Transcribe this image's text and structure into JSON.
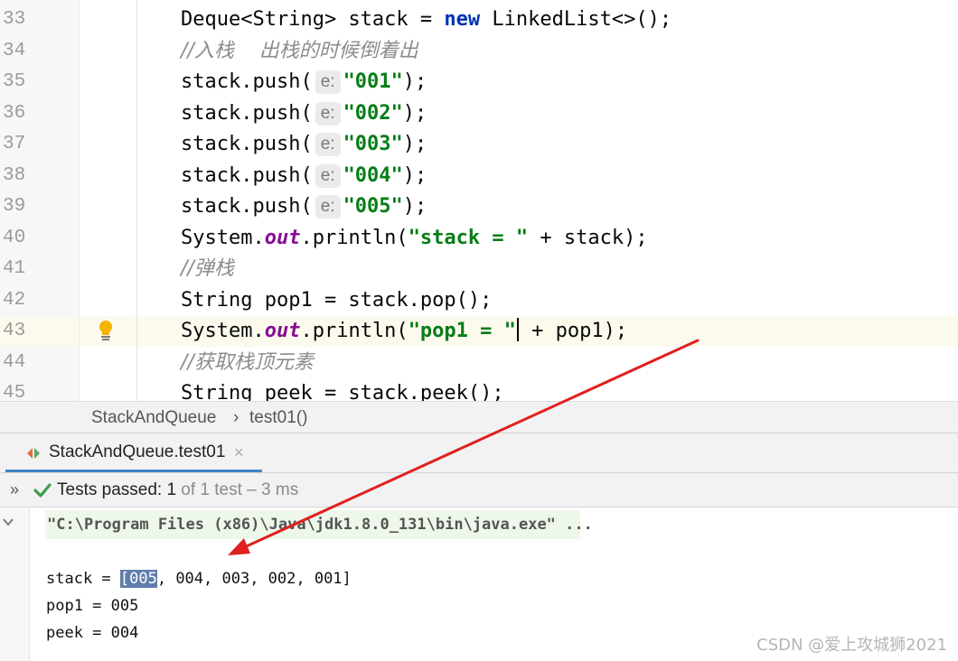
{
  "editor": {
    "lines": [
      {
        "num": "33",
        "parts": [
          [
            "t",
            "Deque<String> stack = "
          ],
          [
            "kw",
            "new"
          ],
          [
            "t",
            " LinkedList<>();"
          ]
        ]
      },
      {
        "num": "34",
        "parts": [
          [
            "cmt",
            "//入栈    出栈的时候倒着出"
          ]
        ]
      },
      {
        "num": "35",
        "parts": [
          [
            "t",
            "stack.push("
          ],
          [
            "hint",
            "e:"
          ],
          [
            "str",
            "\"001\""
          ],
          [
            "t",
            ");"
          ]
        ]
      },
      {
        "num": "36",
        "parts": [
          [
            "t",
            "stack.push("
          ],
          [
            "hint",
            "e:"
          ],
          [
            "str",
            "\"002\""
          ],
          [
            "t",
            ");"
          ]
        ]
      },
      {
        "num": "37",
        "parts": [
          [
            "t",
            "stack.push("
          ],
          [
            "hint",
            "e:"
          ],
          [
            "str",
            "\"003\""
          ],
          [
            "t",
            ");"
          ]
        ]
      },
      {
        "num": "38",
        "parts": [
          [
            "t",
            "stack.push("
          ],
          [
            "hint",
            "e:"
          ],
          [
            "str",
            "\"004\""
          ],
          [
            "t",
            ");"
          ]
        ]
      },
      {
        "num": "39",
        "parts": [
          [
            "t",
            "stack.push("
          ],
          [
            "hint",
            "e:"
          ],
          [
            "str",
            "\"005\""
          ],
          [
            "t",
            ");"
          ]
        ]
      },
      {
        "num": "40",
        "parts": [
          [
            "t",
            "System."
          ],
          [
            "field",
            "out"
          ],
          [
            "t",
            ".println("
          ],
          [
            "str",
            "\"stack = \""
          ],
          [
            "t",
            " + stack);"
          ]
        ]
      },
      {
        "num": "41",
        "parts": [
          [
            "cmt",
            "//弹栈"
          ]
        ]
      },
      {
        "num": "42",
        "parts": [
          [
            "t",
            "String pop1 = stack.pop();"
          ]
        ]
      },
      {
        "num": "43",
        "current": true,
        "bulb": true,
        "parts": [
          [
            "t",
            "System."
          ],
          [
            "field",
            "out"
          ],
          [
            "t",
            ".println("
          ],
          [
            "str",
            "\"pop1 = \""
          ],
          [
            "caret",
            ""
          ],
          [
            "t",
            " + pop1);"
          ]
        ]
      },
      {
        "num": "44",
        "parts": [
          [
            "cmt",
            "//获取栈顶元素"
          ]
        ]
      },
      {
        "num": "45",
        "parts": [
          [
            "t",
            "String peek = stack.peek();"
          ]
        ]
      }
    ]
  },
  "breadcrumb": {
    "class_name": "StackAndQueue",
    "separator": "›",
    "method": "test01()"
  },
  "run_tab": {
    "label": "StackAndQueue.test01",
    "close": "×",
    "icon": "run-config-icon"
  },
  "status": {
    "expand": "»",
    "label": "Tests passed: ",
    "count": "1",
    "tail": " of 1 test – 3 ms",
    "icon": "check-icon"
  },
  "console": {
    "collapse": "✓",
    "command": "\"C:\\Program Files (x86)\\Java\\jdk1.8.0_131\\bin\\java.exe\" ...",
    "stack_prefix": "stack = ",
    "stack_selected": "[005",
    "stack_rest": ", 004, 003, 002, 001]",
    "pop_line": "pop1 = 005",
    "peek_line": "peek = 004"
  },
  "watermark": "CSDN @爱上攻城狮2021",
  "colors": {
    "arrow": "#e02020",
    "selection": "#5f7eac",
    "tab_underline": "#4083c9"
  }
}
